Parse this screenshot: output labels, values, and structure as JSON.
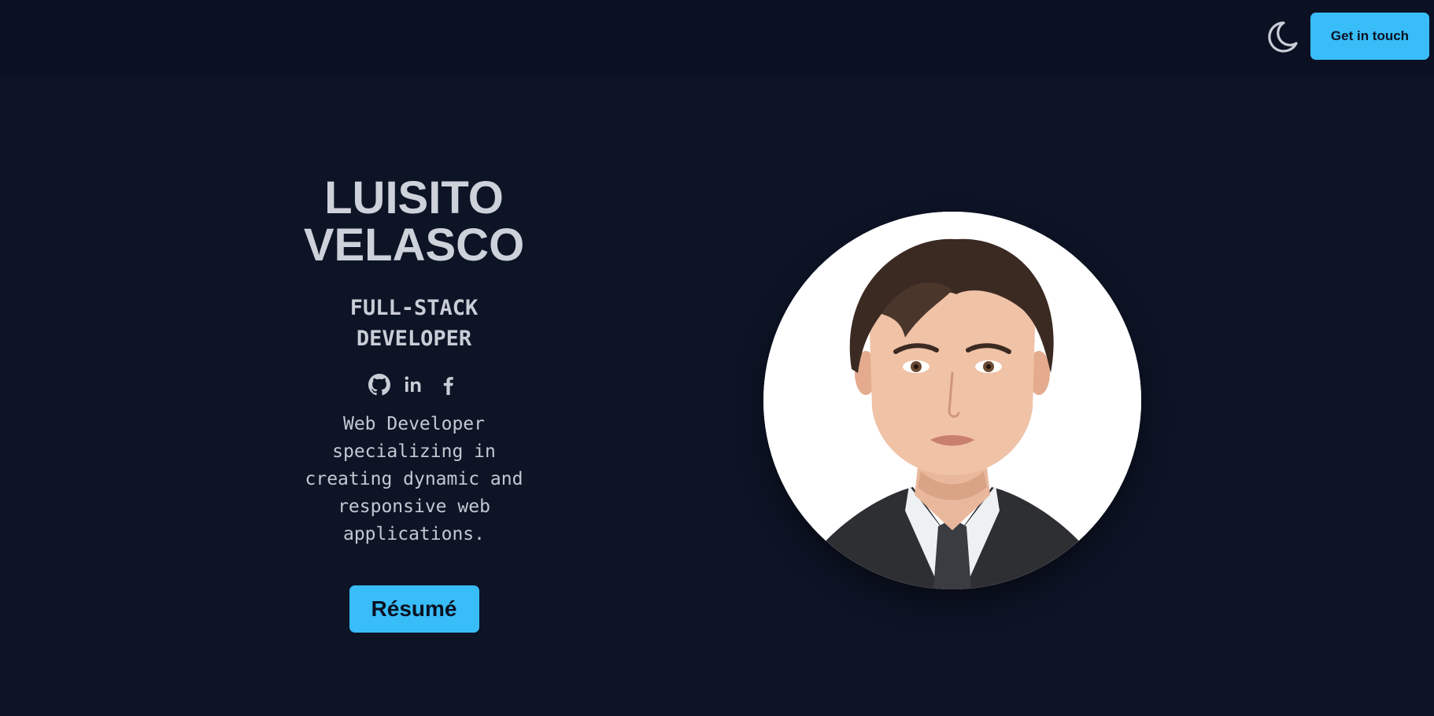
{
  "colors": {
    "background": "#0d1426",
    "topbar": "#0b1122",
    "accent": "#38bdf8",
    "text": "#cdd1da"
  },
  "header": {
    "theme_icon": "moon-icon",
    "cta_label": "Get in touch"
  },
  "hero": {
    "name_first": "LUISITO",
    "name_last": "VELASCO",
    "role": "FULL-STACK DEVELOPER",
    "socials": [
      {
        "icon": "github-icon"
      },
      {
        "icon": "linkedin-icon",
        "glyph": "in"
      },
      {
        "icon": "facebook-icon",
        "glyph": "f"
      }
    ],
    "bio": "Web Developer specializing in creating dynamic and responsive web applications.",
    "resume_label": "Résumé"
  },
  "portrait": {
    "icon": "profile-portrait-illustration"
  }
}
